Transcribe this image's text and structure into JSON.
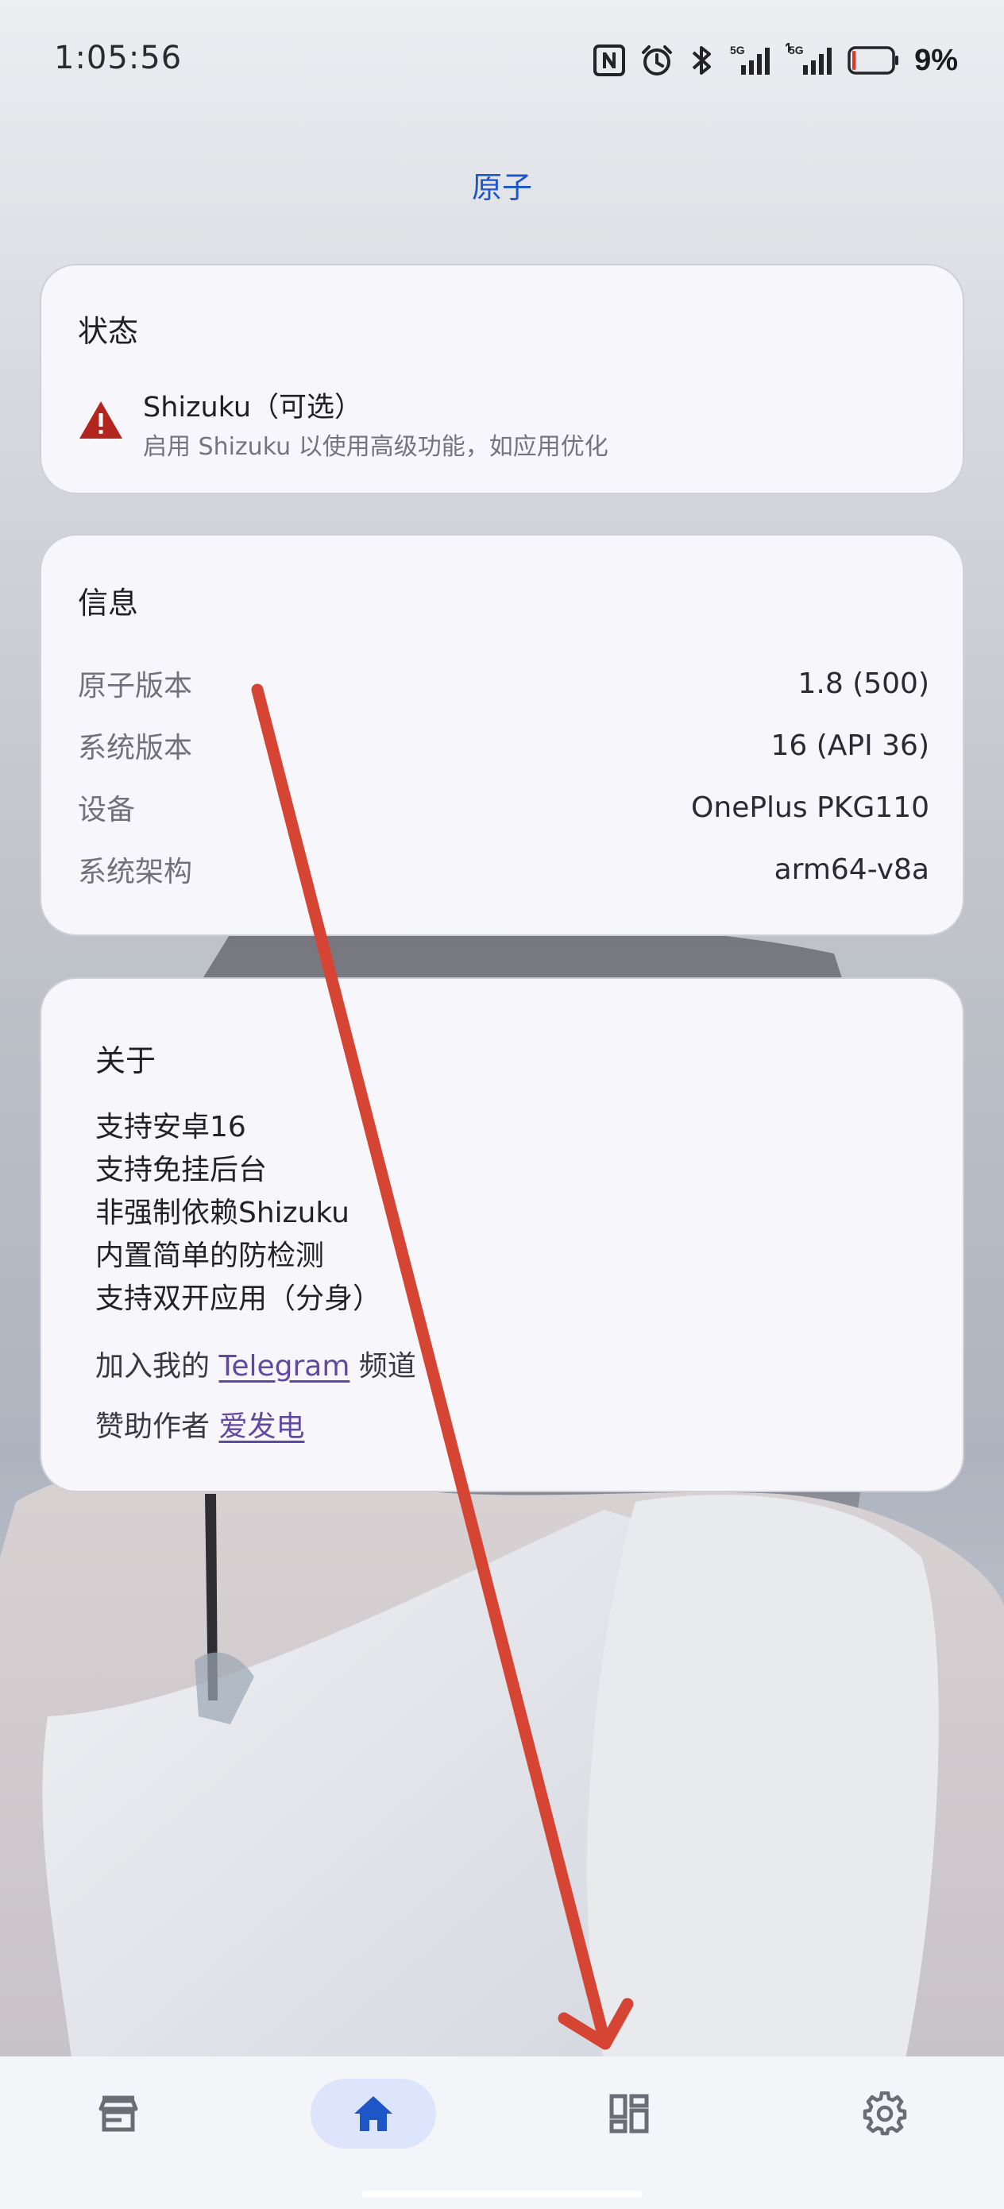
{
  "status_bar": {
    "time": "1:05:56",
    "battery_percent": "9%",
    "battery_level": 0.09,
    "icons": [
      "nfc-icon",
      "alarm-icon",
      "bluetooth-icon",
      "signal-5g-icon",
      "signal-5g-icon",
      "battery-icon"
    ],
    "network_labels": [
      "5G",
      "5G"
    ]
  },
  "header": {
    "title": "原子"
  },
  "status_card": {
    "title": "状态",
    "shizuku_title": "Shizuku（可选）",
    "shizuku_desc": "启用 Shizuku 以使用高级功能，如应用优化",
    "icon": "warning-icon",
    "warning_color": "#b3261e"
  },
  "info_card": {
    "title": "信息",
    "rows": [
      {
        "label": "原子版本",
        "value": "1.8 (500)"
      },
      {
        "label": "系统版本",
        "value": "16 (API 36)"
      },
      {
        "label": "设备",
        "value": "OnePlus PKG110"
      },
      {
        "label": "系统架构",
        "value": "arm64-v8a"
      }
    ]
  },
  "about_card": {
    "title": "关于",
    "lines": [
      "支持安卓16",
      "支持免挂后台",
      "非强制依赖Shizuku",
      "内置简单的防检测",
      "支持双开应用（分身）"
    ],
    "telegram_prefix": "加入我的 ",
    "telegram_link": "Telegram",
    "telegram_suffix": " 频道",
    "donate_prefix": "赞助作者 ",
    "donate_link": "爱发电",
    "link_color": "#6049a3"
  },
  "bottom_nav": {
    "items": [
      {
        "icon": "store-icon",
        "active": false
      },
      {
        "icon": "home-icon",
        "active": true
      },
      {
        "icon": "dashboard-icon",
        "active": false
      },
      {
        "icon": "settings-icon",
        "active": false
      }
    ],
    "active_color": "#1d56c7",
    "active_bg": "#dce5fb"
  },
  "annotation": {
    "type": "arrow",
    "color": "#d64533"
  },
  "colors": {
    "accent": "#1d56c7",
    "card_background": "#f7f7fb"
  }
}
